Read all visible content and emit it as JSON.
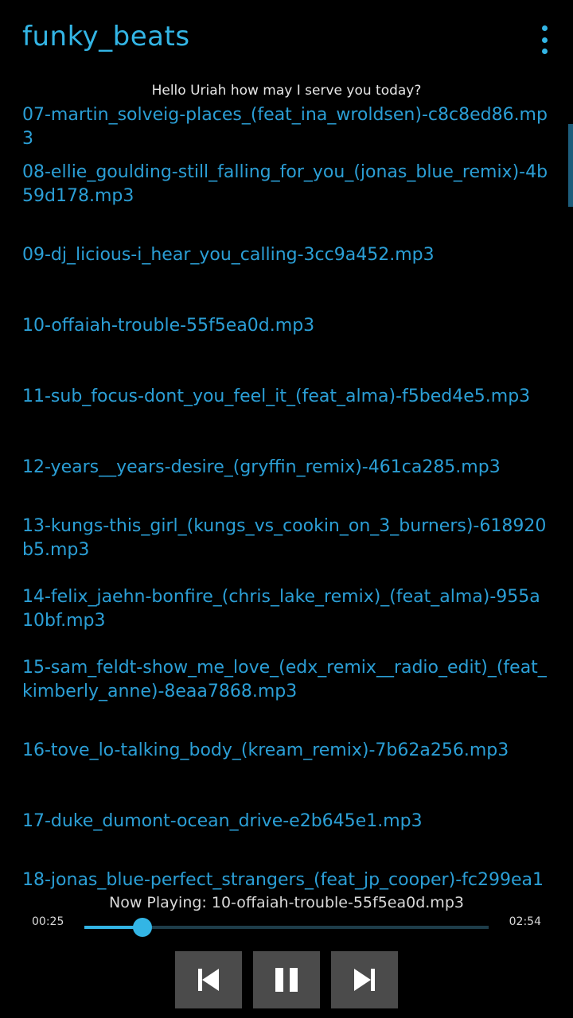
{
  "app": {
    "title": "funky_beats",
    "menu_icon": "overflow-menu-icon"
  },
  "greeting": "Hello Uriah how may I serve you today?",
  "songs": [
    "07-martin_solveig-places_(feat_ina_wroldsen)-c8c8ed86.mp3",
    "08-ellie_goulding-still_falling_for_you_(jonas_blue_remix)-4b59d178.mp3",
    "09-dj_licious-i_hear_you_calling-3cc9a452.mp3",
    "10-offaiah-trouble-55f5ea0d.mp3",
    "11-sub_focus-dont_you_feel_it_(feat_alma)-f5bed4e5.mp3",
    "12-years__years-desire_(gryffin_remix)-461ca285.mp3",
    "13-kungs-this_girl_(kungs_vs_cookin_on_3_burners)-618920b5.mp3",
    "14-felix_jaehn-bonfire_(chris_lake_remix)_(feat_alma)-955a10bf.mp3",
    "15-sam_feldt-show_me_love_(edx_remix__radio_edit)_(feat_kimberly_anne)-8eaa7868.mp3",
    "16-tove_lo-talking_body_(kream_remix)-7b62a256.mp3",
    "17-duke_dumont-ocean_drive-e2b645e1.mp3",
    "18-jonas_blue-perfect_strangers_(feat_jp_cooper)-fc299ea1"
  ],
  "player": {
    "now_playing": "Now Playing: 10-offaiah-trouble-55f5ea0d.mp3",
    "current_time": "00:25",
    "total_time": "02:54",
    "progress": 0.144,
    "controls": {
      "prev": "previous-track-icon",
      "pause": "pause-icon",
      "next": "next-track-icon"
    }
  },
  "colors": {
    "accent": "#33b5e5",
    "list_text": "#2b9fd6",
    "button_bg": "#4b4b4b",
    "background": "#000000"
  }
}
